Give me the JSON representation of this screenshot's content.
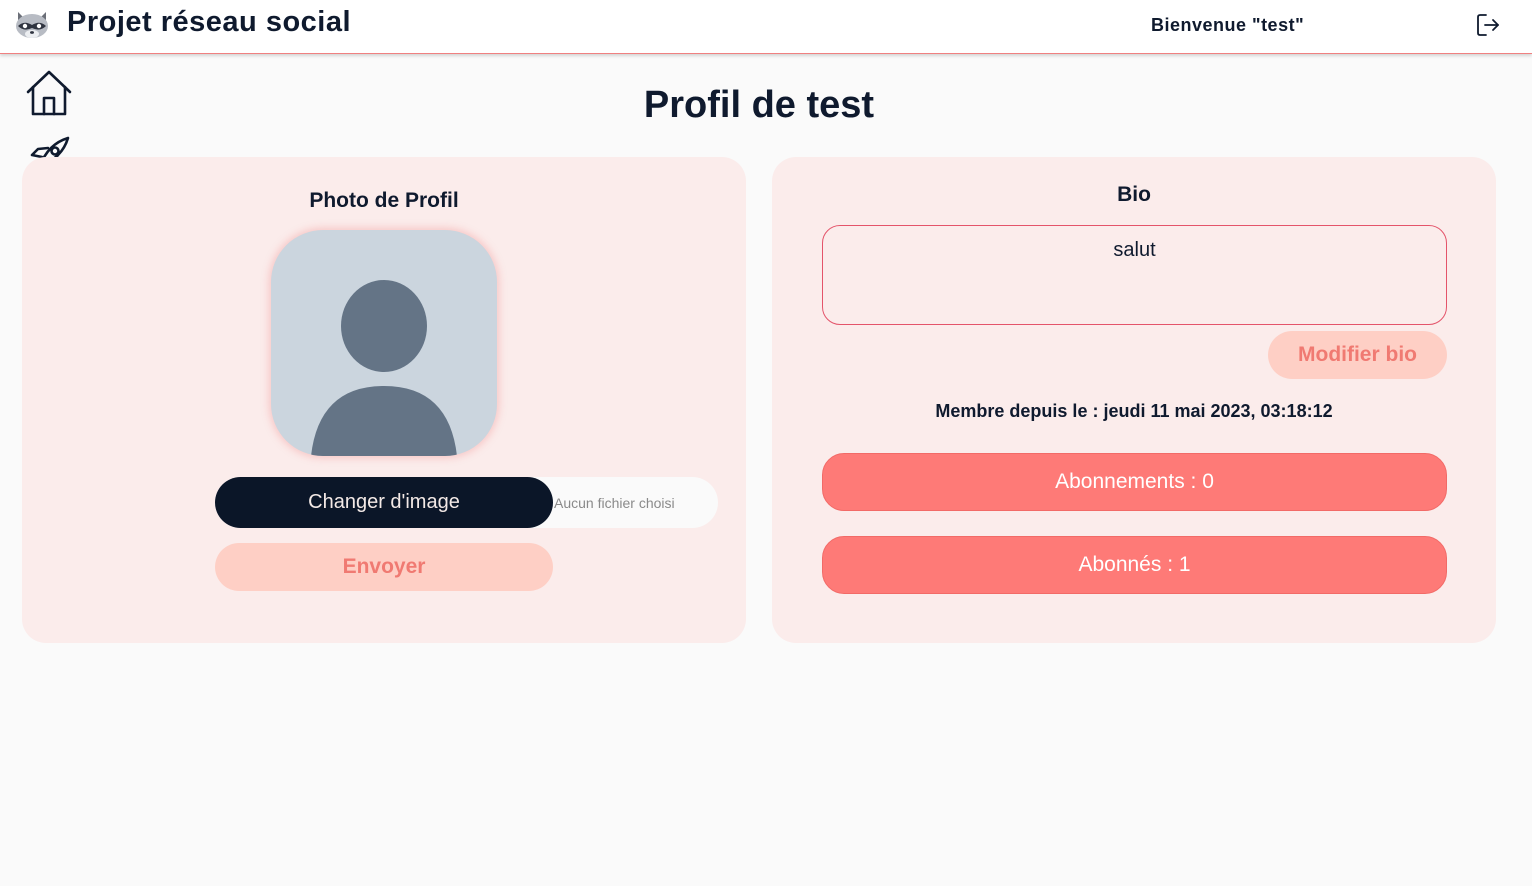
{
  "header": {
    "app_title": "Projet réseau social",
    "welcome": "Bienvenue \"test\"",
    "logo_icon": "raccoon-logo",
    "logout_icon": "logout-icon"
  },
  "sidebar": {
    "items": [
      {
        "icon": "home-icon"
      },
      {
        "icon": "rocket-icon"
      },
      {
        "icon": "user-icon"
      }
    ]
  },
  "page": {
    "title": "Profil de test"
  },
  "photo_card": {
    "heading": "Photo de Profil",
    "change_image_label": "Changer d'image",
    "file_status": "Aucun fichier choisi",
    "send_label": "Envoyer"
  },
  "bio_card": {
    "heading": "Bio",
    "bio_value": "salut",
    "edit_bio_label": "Modifier bio",
    "member_since": "Membre depuis le : jeudi 11 mai 2023, 03:18:12",
    "following_label": "Abonnements : 0",
    "followers_label": "Abonnés : 1"
  },
  "colors": {
    "navy": "#0f1a2e",
    "card_bg": "#fbeceb",
    "accent": "#fe7a77",
    "soft_button": "#fecfc5",
    "soft_button_text": "#f07a72"
  }
}
